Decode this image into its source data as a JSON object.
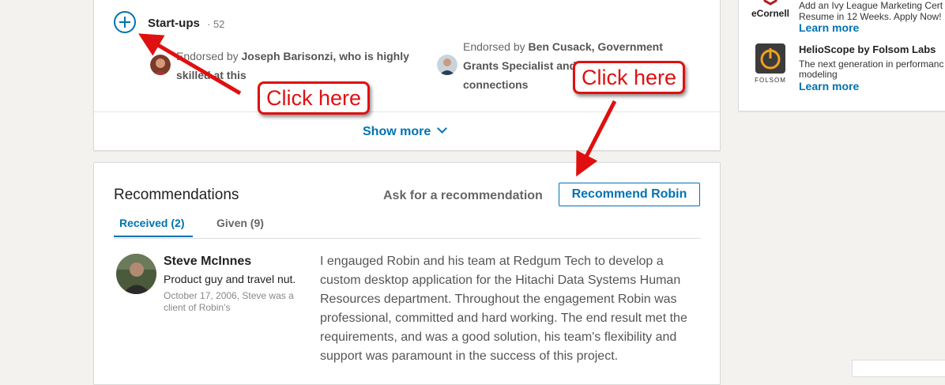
{
  "skills": {
    "skill_name": "Start-ups",
    "skill_count": "· 52",
    "endorsement_left": {
      "prefix": "Endorsed by ",
      "name": "Joseph Barisonzi, who is highly",
      "rest": "skilled at this"
    },
    "endorsement_right": {
      "prefix": "Endorsed by ",
      "name": "Ben Cusack, Government",
      "line2": "Grants Specialist and",
      "line3": "connections"
    },
    "show_more": "Show more"
  },
  "recommendations": {
    "title": "Recommendations",
    "ask_label": "Ask for a recommendation",
    "recommend_button": "Recommend Robin",
    "tabs": [
      {
        "label": "Received (2)",
        "active": true
      },
      {
        "label": "Given (9)",
        "active": false
      }
    ],
    "items": [
      {
        "name": "Steve McInnes",
        "headline": "Product guy and travel nut.",
        "meta": "October 17, 2006, Steve was a client of Robin’s",
        "text": "I engauged Robin and his team at Redgum Tech to develop a custom desktop application for the Hitachi Data Systems Human Resources department. Throughout the engagement Robin was professional, committed and hard working. The end result met the requirements, and was a good solution, his team's flexibility and support was paramount in the success of this project."
      }
    ]
  },
  "ads": [
    {
      "logo_text": "eCornell",
      "line1": "Add an Ivy League Marketing Cert",
      "line2": "Resume in 12 Weeks. Apply Now!",
      "link": "Learn more"
    },
    {
      "logo_text": "FOLSOM",
      "title": "HelioScope by Folsom Labs",
      "line1": "The next generation in performanc",
      "line2": "modeling",
      "link": "Learn more"
    }
  ],
  "annotations": {
    "callout_left": "Click here",
    "callout_right": "Click here",
    "color": "#e01010"
  },
  "colors": {
    "accent": "#0073b1",
    "annotation_red": "#e01010"
  }
}
